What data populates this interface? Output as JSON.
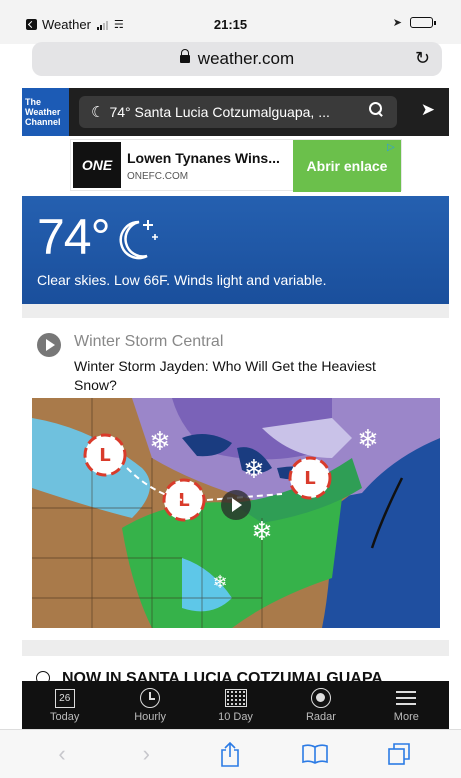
{
  "status_bar": {
    "back_app": "Weather",
    "time": "21:15"
  },
  "browser": {
    "url": "weather.com"
  },
  "twc_header": {
    "logo_line1": "The",
    "logo_line2": "Weather",
    "logo_line3": "Channel",
    "location": "74° Santa Lucia Cotzumalguapa, ..."
  },
  "ad": {
    "logo": "ONE",
    "title": "Lowen Tynanes Wins...",
    "domain": "ONEFC.COM",
    "cta": "Abrir enlace"
  },
  "current": {
    "temperature": "74°",
    "description": "Clear skies. Low 66F. Winds light and variable."
  },
  "news": {
    "section": "Winter Storm Central",
    "headline": "Winter Storm Jayden: Who Will Get the Heaviest Snow?"
  },
  "next_section": {
    "label": "NOW IN SANTA LUCIA COTZUMALGUAPA"
  },
  "tabs": [
    {
      "label": "Today",
      "icon": "calendar-icon",
      "day": "26"
    },
    {
      "label": "Hourly",
      "icon": "clock-icon"
    },
    {
      "label": "10 Day",
      "icon": "grid-icon"
    },
    {
      "label": "Radar",
      "icon": "radar-icon"
    },
    {
      "label": "More",
      "icon": "menu-icon"
    }
  ],
  "safari_toolbar": {
    "back": "‹",
    "forward": "›"
  }
}
